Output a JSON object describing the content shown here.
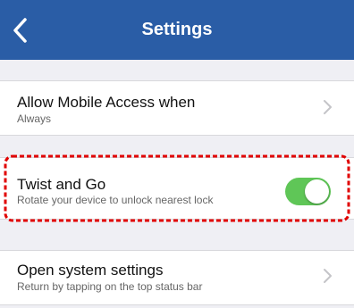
{
  "header": {
    "title": "Settings",
    "back_icon": "chevron-left-icon",
    "background_color": "#2a5da6"
  },
  "settings": {
    "mobile_access": {
      "title": "Allow Mobile Access when",
      "value": "Always"
    },
    "twist_and_go": {
      "title": "Twist and Go",
      "description": "Rotate your device to unlock nearest lock",
      "enabled": true,
      "toggle_color": "#5fc657"
    },
    "system_settings": {
      "title": "Open system settings",
      "description": "Return by tapping on the top status bar"
    }
  },
  "annotation": {
    "type": "dashed-highlight",
    "color": "#e00000"
  }
}
